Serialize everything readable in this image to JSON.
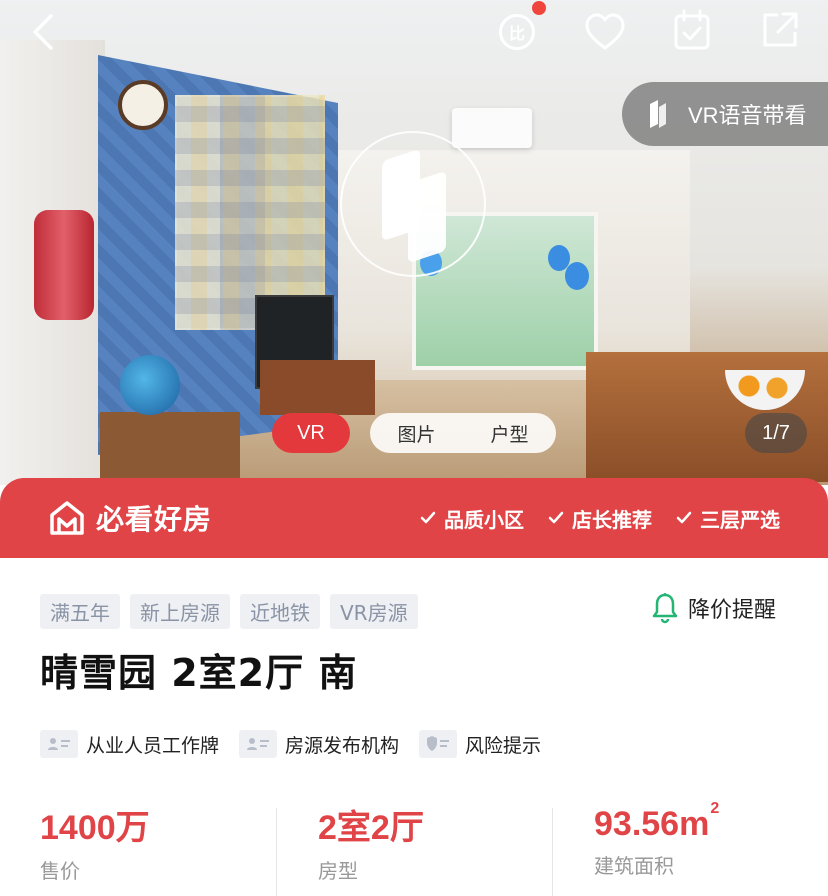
{
  "hero": {
    "vr_guide_label": "VR语音带看",
    "media_tabs": [
      "VR",
      "图片",
      "户型"
    ],
    "active_tab": "VR",
    "image_counter": "1/7"
  },
  "topbar": {
    "compare_icon_text": "比",
    "icons": [
      "back-icon",
      "compare-icon",
      "heart-icon",
      "calendar-check-icon",
      "share-icon"
    ]
  },
  "banner": {
    "brand": "必看好房",
    "badges": [
      "品质小区",
      "店长推荐",
      "三层严选"
    ]
  },
  "tags": [
    "满五年",
    "新上房源",
    "近地铁",
    "VR房源"
  ],
  "price_alert": "降价提醒",
  "title": "晴雪园 2室2厅 南",
  "certs": [
    "从业人员工作牌",
    "房源发布机构",
    "风险提示"
  ],
  "stats": [
    {
      "value": "1400万",
      "label": "售价"
    },
    {
      "value": "2室2厅",
      "label": "房型"
    },
    {
      "value": "93.56m",
      "sup": "2",
      "label": "建筑面积"
    }
  ],
  "colors": {
    "accent": "#e04447",
    "tag_bg": "#eef0f3",
    "tag_text": "#8a94a6"
  }
}
